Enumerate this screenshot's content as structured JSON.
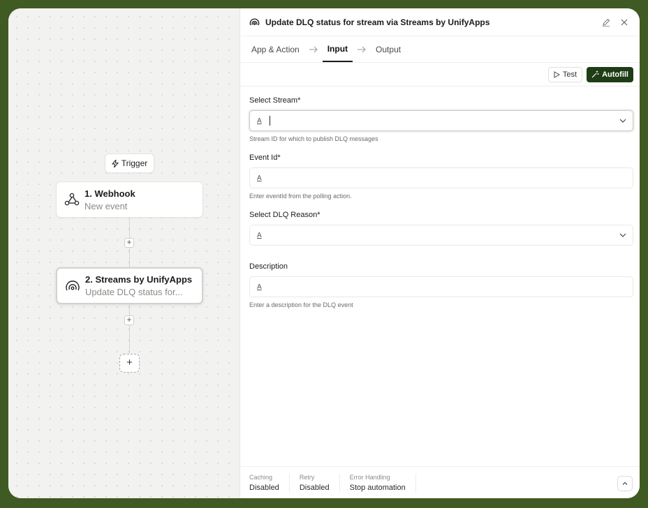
{
  "canvas": {
    "trigger_label": "Trigger",
    "nodes": [
      {
        "title": "1. Webhook",
        "subtitle": "New event",
        "icon": "webhook-icon"
      },
      {
        "title": "2. Streams by UnifyApps",
        "subtitle": "Update DLQ status for...",
        "icon": "streams-icon"
      }
    ],
    "plus": "+"
  },
  "panel": {
    "title": "Update DLQ status for stream via Streams by UnifyApps",
    "tabs": [
      "App & Action",
      "Input",
      "Output"
    ],
    "active_tab": "Input",
    "test_label": "Test",
    "autofill_label": "Autofill",
    "fields": [
      {
        "label": "Select Stream*",
        "hint": "Stream ID for which to publish DLQ messages",
        "type": "dropdown",
        "focused": true
      },
      {
        "label": "Event Id*",
        "hint": "Enter eventId from the polling action.",
        "type": "text"
      },
      {
        "label": "Select DLQ Reason*",
        "hint": "",
        "type": "dropdown"
      },
      {
        "label": "Description",
        "hint": "Enter a description for the DLQ event",
        "type": "text"
      }
    ],
    "field_icon_text": "A",
    "footer": [
      {
        "key": "Caching",
        "value": "Disabled"
      },
      {
        "key": "Retry",
        "value": "Disabled"
      },
      {
        "key": "Error Handling",
        "value": "Stop automation"
      }
    ]
  },
  "colors": {
    "frame": "#3f5a22",
    "accent": "#1e3d16"
  }
}
